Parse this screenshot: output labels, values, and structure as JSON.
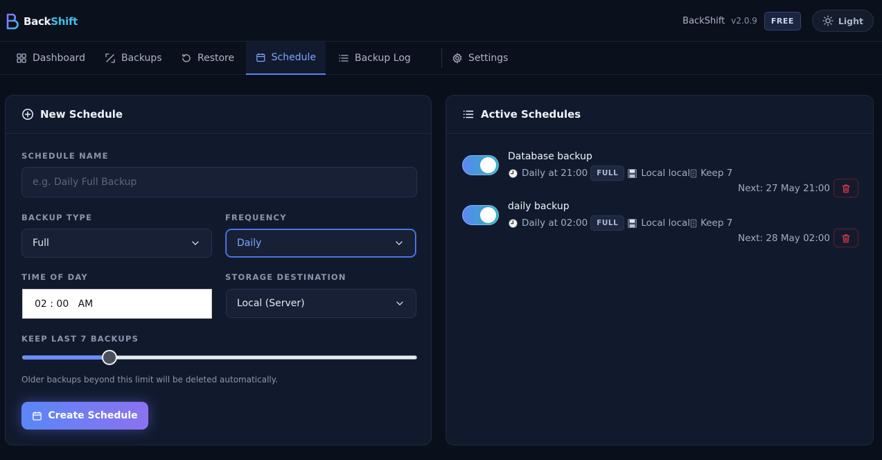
{
  "header": {
    "logo_part1": "Back",
    "logo_part2": "Shift",
    "app_name": "BackShift",
    "version": "v2.0.9",
    "plan": "FREE",
    "theme_toggle": "Light"
  },
  "nav": {
    "tabs": [
      {
        "label": "Dashboard",
        "icon": "grid-icon"
      },
      {
        "label": "Backups",
        "icon": "percent-icon"
      },
      {
        "label": "Restore",
        "icon": "undo-icon"
      },
      {
        "label": "Schedule",
        "icon": "calendar-icon",
        "active": true
      },
      {
        "label": "Backup Log",
        "icon": "list-icon"
      },
      {
        "label": "Settings",
        "icon": "gear-icon"
      }
    ]
  },
  "new_schedule": {
    "title": "New Schedule",
    "name_label": "SCHEDULE NAME",
    "name_placeholder": "e.g. Daily Full Backup",
    "type_label": "BACKUP TYPE",
    "type_value": "Full",
    "freq_label": "FREQUENCY",
    "freq_value": "Daily",
    "time_label": "TIME OF DAY",
    "time_value": "02 : 00   AM",
    "storage_label": "STORAGE DESTINATION",
    "storage_value": "Local (Server)",
    "keep_label": "KEEP LAST 7 BACKUPS",
    "keep_value_fraction": 0.22,
    "help_text": "Older backups beyond this limit will be deleted automatically.",
    "create_button": "Create Schedule"
  },
  "active_schedules": {
    "title": "Active Schedules",
    "items": [
      {
        "name": "Database backup",
        "when": "Daily at 21:00",
        "type": "FULL",
        "storage": "Local local",
        "keep": "Keep 7",
        "next": "Next: 27 May 21:00",
        "enabled": true
      },
      {
        "name": "daily backup",
        "when": "Daily at 02:00",
        "type": "FULL",
        "storage": "Local local",
        "keep": "Keep 7",
        "next": "Next: 28 May 02:00",
        "enabled": true
      }
    ]
  },
  "colors": {
    "accent": "#5b85f7",
    "accent_text": "#7fa6ff",
    "danger": "#e0364f",
    "background": "#0a0f1c",
    "panel": "#111a2d"
  }
}
